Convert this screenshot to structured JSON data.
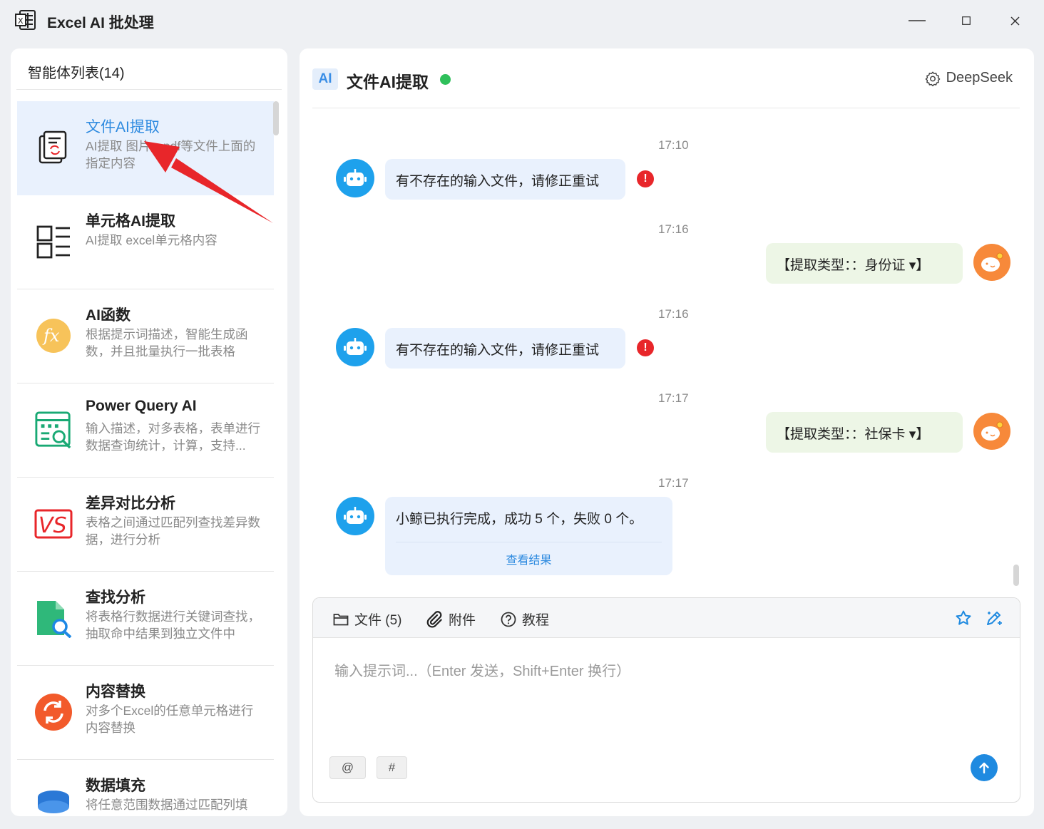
{
  "window": {
    "title": "Excel AI 批处理"
  },
  "sidebar": {
    "header": "智能体列表(14)",
    "items": [
      {
        "name": "文件AI提取",
        "desc": "AI提取 图片、pdf等文件上面的指定内容",
        "icon": "document-extract-icon"
      },
      {
        "name": "单元格AI提取",
        "desc": "AI提取 excel单元格内容",
        "icon": "grid-list-icon"
      },
      {
        "name": "AI函数",
        "desc": "根据提示词描述，智能生成函数，并且批量执行一批表格",
        "icon": "fx-icon"
      },
      {
        "name": "Power Query AI",
        "desc": "输入描述，对多表格，表单进行数据查询统计，计算，支持...",
        "icon": "query-table-icon"
      },
      {
        "name": "差异对比分析",
        "desc": "表格之间通过匹配列查找差异数据，进行分析",
        "icon": "vs-icon"
      },
      {
        "name": "查找分析",
        "desc": "将表格行数据进行关键词查找，抽取命中结果到独立文件中",
        "icon": "file-search-icon"
      },
      {
        "name": "内容替换",
        "desc": "对多个Excel的任意单元格进行内容替换",
        "icon": "replace-icon"
      },
      {
        "name": "数据填充",
        "desc": "将任意范围数据通过匹配列填",
        "icon": "database-icon"
      }
    ]
  },
  "chat": {
    "badge": "AI",
    "title": "文件AI提取",
    "model": "DeepSeek",
    "messages": [
      {
        "time": "17:10",
        "role": "bot",
        "text": "有不存在的输入文件，请修正重试",
        "error": true
      },
      {
        "time": "17:16",
        "role": "user",
        "text": "【提取类型：：身份证 ▾】"
      },
      {
        "time": "17:16",
        "role": "bot",
        "text": "有不存在的输入文件，请修正重试",
        "error": true
      },
      {
        "time": "17:17",
        "role": "user",
        "text": "【提取类型：：社保卡 ▾】"
      },
      {
        "time": "17:17",
        "role": "bot",
        "text": "小鲸已执行完成，成功 5 个，失败 0 个。",
        "link": "查看结果"
      }
    ]
  },
  "composer": {
    "files_label": "文件 (5)",
    "attach_label": "附件",
    "tutorial_label": "教程",
    "placeholder": "输入提示词...（Enter 发送，Shift+Enter 换行）",
    "chip_at": "@",
    "chip_hash": "#"
  },
  "colors": {
    "accent": "#2f8be0",
    "bot_bubble": "#e9f1fd",
    "user_bubble": "#edf6e6",
    "error": "#e8262a",
    "status_online": "#2fc05b",
    "annotation_arrow": "#e8262a"
  }
}
